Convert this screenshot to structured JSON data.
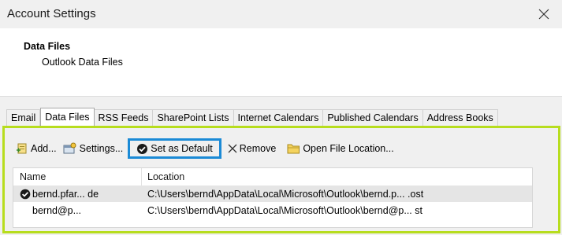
{
  "window": {
    "title": "Account Settings",
    "close_icon": "close-icon"
  },
  "header": {
    "title": "Data Files",
    "subtitle": "Outlook Data Files"
  },
  "tabs": [
    {
      "label": "Email",
      "active": false
    },
    {
      "label": "Data Files",
      "active": true
    },
    {
      "label": "RSS Feeds",
      "active": false
    },
    {
      "label": "SharePoint Lists",
      "active": false
    },
    {
      "label": "Internet Calendars",
      "active": false
    },
    {
      "label": "Published Calendars",
      "active": false
    },
    {
      "label": "Address Books",
      "active": false
    }
  ],
  "toolbar": {
    "add_label": "Add...",
    "settings_label": "Settings...",
    "set_default_label": "Set as Default",
    "remove_label": "Remove",
    "open_location_label": "Open File Location..."
  },
  "list": {
    "columns": [
      "Name",
      "Location"
    ],
    "rows": [
      {
        "name": "bernd.pfar... de",
        "location": "C:\\Users\\bernd\\AppData\\Local\\Microsoft\\Outlook\\bernd.p... .ost",
        "default": true
      },
      {
        "name": "bernd@p...",
        "location": "C:\\Users\\bernd\\AppData\\Local\\Microsoft\\Outlook\\bernd@p... st",
        "default": false
      }
    ]
  },
  "colors": {
    "panel_highlight": "#b7dd1e",
    "button_highlight": "#1b8ad6"
  }
}
